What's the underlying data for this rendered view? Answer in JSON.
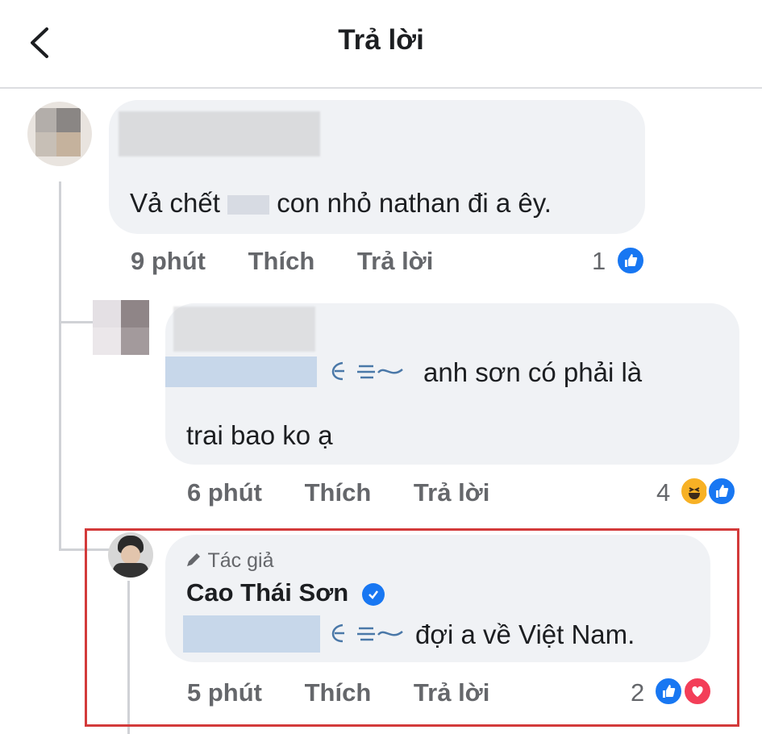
{
  "header": {
    "title": "Trả lời"
  },
  "comments": [
    {
      "text": "Vả chết",
      "text_cont": "con nhỏ nathan đi a êy.",
      "time": "9 phút",
      "like": "Thích",
      "reply": "Trả lời",
      "reaction_count": "1",
      "reactions": [
        "like-icon"
      ]
    },
    {
      "text_line1": "anh sơn có phải là",
      "text_line2": "trai bao ko ạ",
      "time": "6 phút",
      "like": "Thích",
      "reply": "Trả lời",
      "reaction_count": "4",
      "reactions": [
        "haha-icon",
        "like-icon"
      ]
    },
    {
      "author_badge": "Tác giả",
      "author_name": "Cao Thái Sơn",
      "text": "đợi a về Việt Nam.",
      "time": "5 phút",
      "like": "Thích",
      "reply": "Trả lời",
      "reaction_count": "2",
      "reactions": [
        "like-icon",
        "love-icon"
      ]
    }
  ],
  "colors": {
    "accent": "#1877f2",
    "highlight_border": "#d33a3a",
    "love": "#f33e58",
    "haha": "#f7b125"
  }
}
